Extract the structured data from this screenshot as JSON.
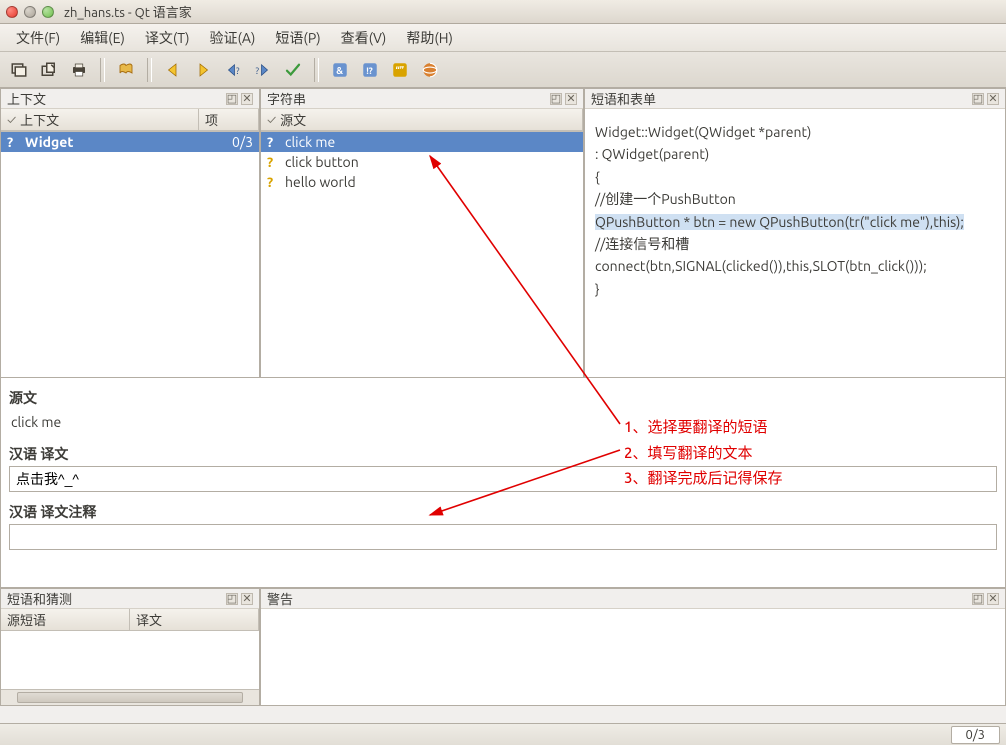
{
  "window": {
    "title": "zh_hans.ts - Qt 语言家"
  },
  "menu": {
    "file": "文件(F)",
    "edit": "编辑(E)",
    "trans": "译文(T)",
    "valid": "验证(A)",
    "phrase": "短语(P)",
    "view": "查看(V)",
    "help": "帮助(H)"
  },
  "panels": {
    "context": {
      "title": "上下文",
      "col_ctx": "上下文",
      "col_items": "项",
      "row_name": "Widget",
      "row_count": "0/3"
    },
    "strings": {
      "title": "字符串",
      "col_src": "源文",
      "items": [
        "click me",
        "click button",
        "hello world"
      ],
      "selected": 0
    },
    "phrases": {
      "title": "短语和表单",
      "code": [
        "Widget::Widget(QWidget *parent)",
        "    : QWidget(parent)",
        "{",
        "    //创建一个PushButton",
        "    QPushButton * btn = new QPushButton(tr(\"click me\"),this);",
        "    //连接信号和槽",
        "    connect(btn,SIGNAL(clicked()),this,SLOT(btn_click()));",
        "}"
      ],
      "hl_index": 4
    },
    "editor": {
      "src_label": "源文",
      "src_text": "click me",
      "trans_label": "汉语 译文",
      "trans_value": "点击我^_^",
      "comment_label": "汉语 译文注释"
    },
    "guesses": {
      "title": "短语和猜测",
      "col_src": "源短语",
      "col_trans": "译文"
    },
    "warnings": {
      "title": "警告"
    }
  },
  "status": {
    "counter": "0/3"
  },
  "annotations": {
    "l1": "1、选择要翻译的短语",
    "l2": "2、填写翻译的文本",
    "l3": "3、翻译完成后记得保存"
  }
}
